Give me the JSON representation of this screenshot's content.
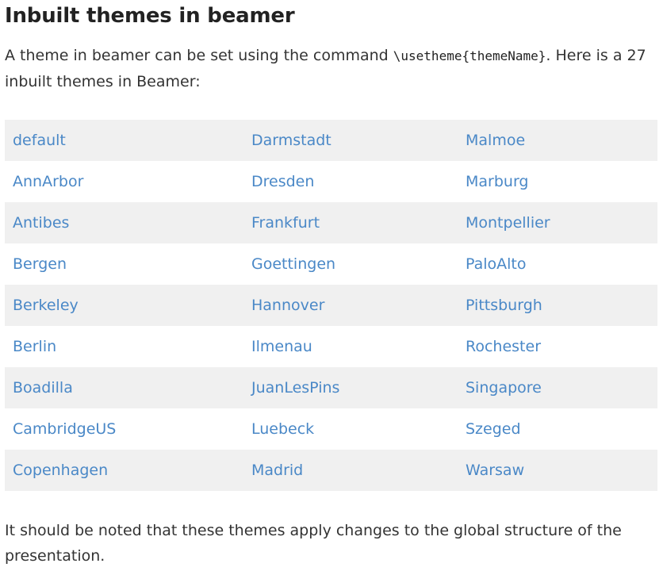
{
  "heading": "Inbuilt themes in beamer",
  "intro": {
    "before": "A theme in beamer can be set using the command ",
    "command": "\\usetheme{themeName}",
    "after": ". Here is a 27 inbuilt themes in Beamer:"
  },
  "themes_table": {
    "rows": [
      [
        "default",
        "Darmstadt",
        "Malmoe"
      ],
      [
        "AnnArbor",
        "Dresden",
        "Marburg"
      ],
      [
        "Antibes",
        "Frankfurt",
        "Montpellier"
      ],
      [
        "Bergen",
        "Goettingen",
        "PaloAlto"
      ],
      [
        "Berkeley",
        "Hannover",
        "Pittsburgh"
      ],
      [
        "Berlin",
        "Ilmenau",
        "Rochester"
      ],
      [
        "Boadilla",
        "JuanLesPins",
        "Singapore"
      ],
      [
        "CambridgeUS",
        "Luebeck",
        "Szeged"
      ],
      [
        "Copenhagen",
        "Madrid",
        "Warsaw"
      ]
    ]
  },
  "note": "It should be noted that these themes apply changes to the global structure of the presentation.",
  "colors": {
    "link": "#4a88c7",
    "row_stripe": "#f0f0f0",
    "text": "#333333",
    "heading": "#222222"
  }
}
